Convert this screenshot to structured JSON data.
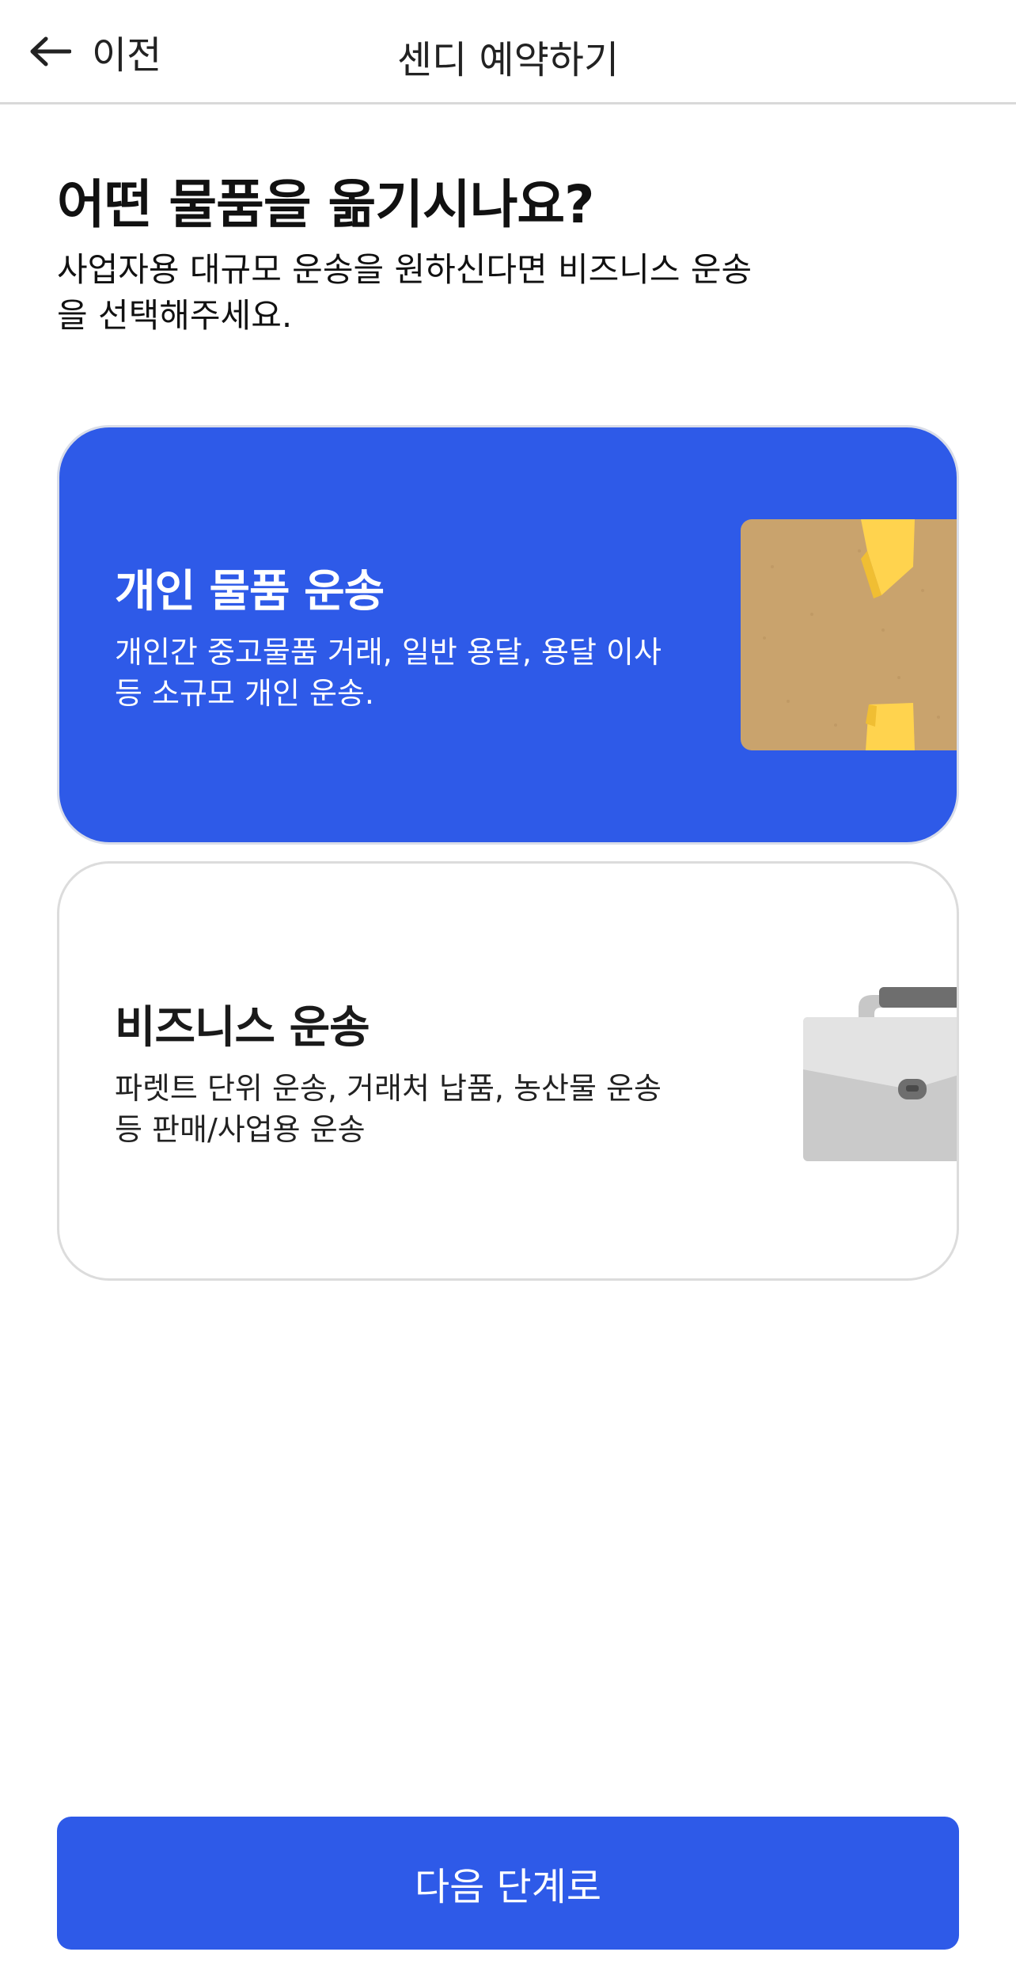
{
  "header": {
    "back_label": "이전",
    "title": "센디 예약하기"
  },
  "main": {
    "title": "어떤 물품을 옮기시나요?",
    "description": "사업자용 대규모 운송을 원하신다면 비즈니스 운송을 선택해주세요."
  },
  "options": [
    {
      "title": "개인 물품 운송",
      "description": "개인간 중고물품 거래, 일반 용달, 용달 이사 등 소규모 개인 운송.",
      "icon": "cardboard-box-icon",
      "selected": true
    },
    {
      "title": "비즈니스 운송",
      "description": "파렛트 단위 운송, 거래처 납품, 농산물 운송 등 판매/사업용 운송",
      "icon": "briefcase-icon",
      "selected": false
    }
  ],
  "footer": {
    "next_label": "다음 단계로"
  },
  "colors": {
    "accent": "#2E5AE8",
    "box": "#C9A36D",
    "tape": "#FFD34E",
    "briefcase": "#CACACA"
  }
}
